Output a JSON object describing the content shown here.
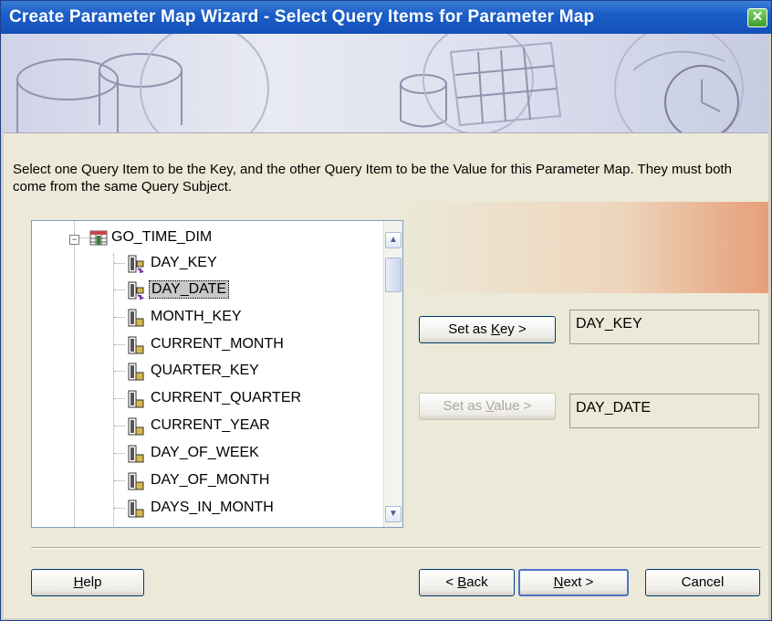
{
  "window": {
    "title": "Create Parameter Map Wizard - Select Query Items for Parameter Map"
  },
  "instructions": "Select one Query Item to be the Key, and the other Query Item to be the Value for this Parameter Map.  They must both come from the same Query Subject.",
  "tree": {
    "root": "GO_TIME_DIM",
    "items": [
      "DAY_KEY",
      "DAY_DATE",
      "MONTH_KEY",
      "CURRENT_MONTH",
      "QUARTER_KEY",
      "CURRENT_QUARTER",
      "CURRENT_YEAR",
      "DAY_OF_WEEK",
      "DAY_OF_MONTH",
      "DAYS_IN_MONTH"
    ],
    "selected": "DAY_DATE"
  },
  "key": {
    "button_pre": "Set as ",
    "button_accel": "K",
    "button_post": "ey >",
    "value": "DAY_KEY"
  },
  "value": {
    "button_pre": "Set as ",
    "button_accel": "V",
    "button_post": "alue >",
    "value": "DAY_DATE"
  },
  "footer": {
    "help_accel": "H",
    "help_rest": "elp",
    "back_pre": "< ",
    "back_accel": "B",
    "back_rest": "ack",
    "next_accel": "N",
    "next_rest": "ext >",
    "cancel": "Cancel"
  },
  "colors": {
    "titlebar": "#1b5ec8",
    "selection": "#c8c8c8",
    "accent_band": "#e6966e"
  }
}
